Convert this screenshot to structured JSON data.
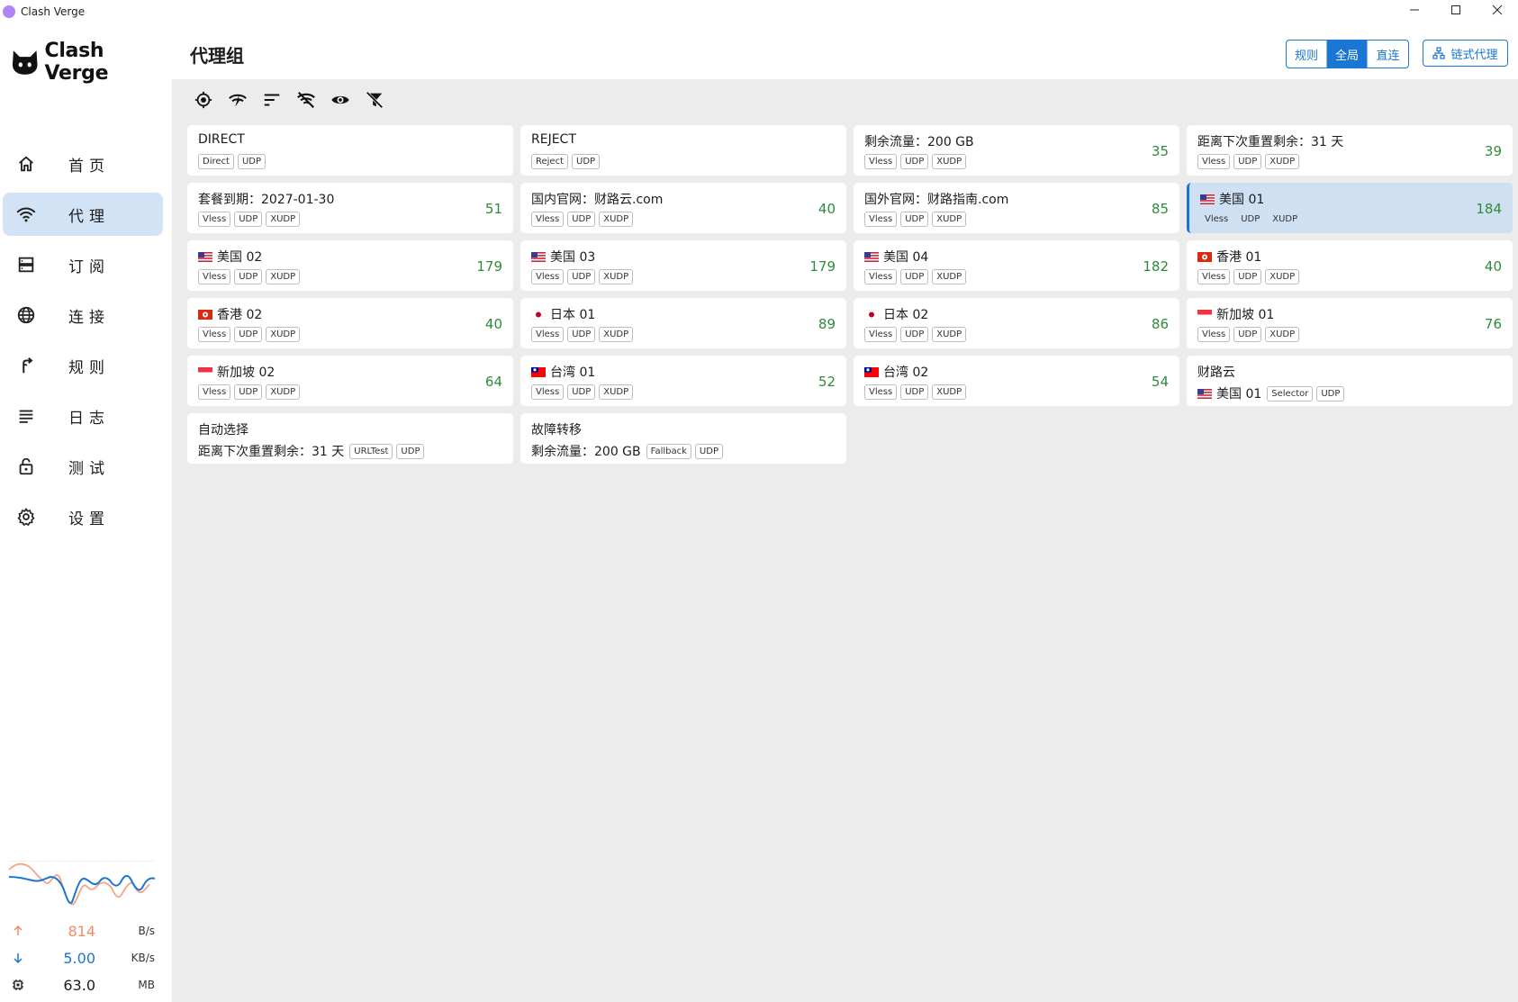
{
  "window": {
    "title": "Clash Verge"
  },
  "brand": {
    "name": "Clash Verge"
  },
  "nav": [
    {
      "id": "home",
      "label": "首页",
      "icon": "home-icon"
    },
    {
      "id": "proxy",
      "label": "代理",
      "icon": "wifi-icon",
      "active": true
    },
    {
      "id": "subscription",
      "label": "订阅",
      "icon": "storage-icon"
    },
    {
      "id": "connections",
      "label": "连接",
      "icon": "globe-icon"
    },
    {
      "id": "rules",
      "label": "规则",
      "icon": "fork-icon"
    },
    {
      "id": "logs",
      "label": "日志",
      "icon": "list-icon"
    },
    {
      "id": "test",
      "label": "测试",
      "icon": "lock-icon"
    },
    {
      "id": "settings",
      "label": "设置",
      "icon": "gear-icon"
    }
  ],
  "traffic": {
    "upload": {
      "value": "814",
      "unit": "B/s",
      "color": "#f08b6a"
    },
    "download": {
      "value": "5.00",
      "unit": "KB/s",
      "color": "#1976d2"
    },
    "memory": {
      "value": "63.0",
      "unit": "MB"
    }
  },
  "header": {
    "title": "代理组",
    "modes": [
      {
        "label": "规则",
        "active": false
      },
      {
        "label": "全局",
        "active": true
      },
      {
        "label": "直连",
        "active": false
      }
    ],
    "chain_label": "链式代理"
  },
  "toolbar": [
    "locate-icon",
    "speedtest-icon",
    "sort-icon",
    "filter-off-icon",
    "eye-icon",
    "filter-clear-icon"
  ],
  "proxies": [
    {
      "name": "DIRECT",
      "tags": [
        "Direct",
        "UDP"
      ],
      "delay": ""
    },
    {
      "name": "REJECT",
      "tags": [
        "Reject",
        "UDP"
      ],
      "delay": ""
    },
    {
      "name": "剩余流量：200 GB",
      "tags": [
        "Vless",
        "UDP",
        "XUDP"
      ],
      "delay": "35"
    },
    {
      "name": "距离下次重置剩余：31 天",
      "tags": [
        "Vless",
        "UDP",
        "XUDP"
      ],
      "delay": "39"
    },
    {
      "name": "套餐到期：2027-01-30",
      "tags": [
        "Vless",
        "UDP",
        "XUDP"
      ],
      "delay": "51"
    },
    {
      "name": "国内官网：财路云.com",
      "tags": [
        "Vless",
        "UDP",
        "XUDP"
      ],
      "delay": "40"
    },
    {
      "name": "国外官网：财路指南.com",
      "tags": [
        "Vless",
        "UDP",
        "XUDP"
      ],
      "delay": "85"
    },
    {
      "name": "美国 01",
      "flag": "us",
      "tags": [
        "Vless",
        "UDP",
        "XUDP"
      ],
      "delay": "184",
      "selected": true
    },
    {
      "name": "美国 02",
      "flag": "us",
      "tags": [
        "Vless",
        "UDP",
        "XUDP"
      ],
      "delay": "179"
    },
    {
      "name": "美国 03",
      "flag": "us",
      "tags": [
        "Vless",
        "UDP",
        "XUDP"
      ],
      "delay": "179"
    },
    {
      "name": "美国 04",
      "flag": "us",
      "tags": [
        "Vless",
        "UDP",
        "XUDP"
      ],
      "delay": "182"
    },
    {
      "name": "香港 01",
      "flag": "hk",
      "tags": [
        "Vless",
        "UDP",
        "XUDP"
      ],
      "delay": "40"
    },
    {
      "name": "香港 02",
      "flag": "hk",
      "tags": [
        "Vless",
        "UDP",
        "XUDP"
      ],
      "delay": "40"
    },
    {
      "name": "日本 01",
      "flag": "jp",
      "tags": [
        "Vless",
        "UDP",
        "XUDP"
      ],
      "delay": "89"
    },
    {
      "name": "日本 02",
      "flag": "jp",
      "tags": [
        "Vless",
        "UDP",
        "XUDP"
      ],
      "delay": "86"
    },
    {
      "name": "新加坡 01",
      "flag": "sg",
      "tags": [
        "Vless",
        "UDP",
        "XUDP"
      ],
      "delay": "76"
    },
    {
      "name": "新加坡 02",
      "flag": "sg",
      "tags": [
        "Vless",
        "UDP",
        "XUDP"
      ],
      "delay": "64"
    },
    {
      "name": "台湾 01",
      "flag": "tw",
      "tags": [
        "Vless",
        "UDP",
        "XUDP"
      ],
      "delay": "52"
    },
    {
      "name": "台湾 02",
      "flag": "tw",
      "tags": [
        "Vless",
        "UDP",
        "XUDP"
      ],
      "delay": "54"
    },
    {
      "name": "财路云",
      "sub": "美国 01",
      "sub_flag": "us",
      "tags": [
        "Selector",
        "UDP"
      ],
      "delay": ""
    },
    {
      "name": "自动选择",
      "sub": "距离下次重置剩余：31 天",
      "tags": [
        "URLTest",
        "UDP"
      ],
      "delay": ""
    },
    {
      "name": "故障转移",
      "sub": "剩余流量：200 GB",
      "tags": [
        "Fallback",
        "UDP"
      ],
      "delay": ""
    }
  ]
}
